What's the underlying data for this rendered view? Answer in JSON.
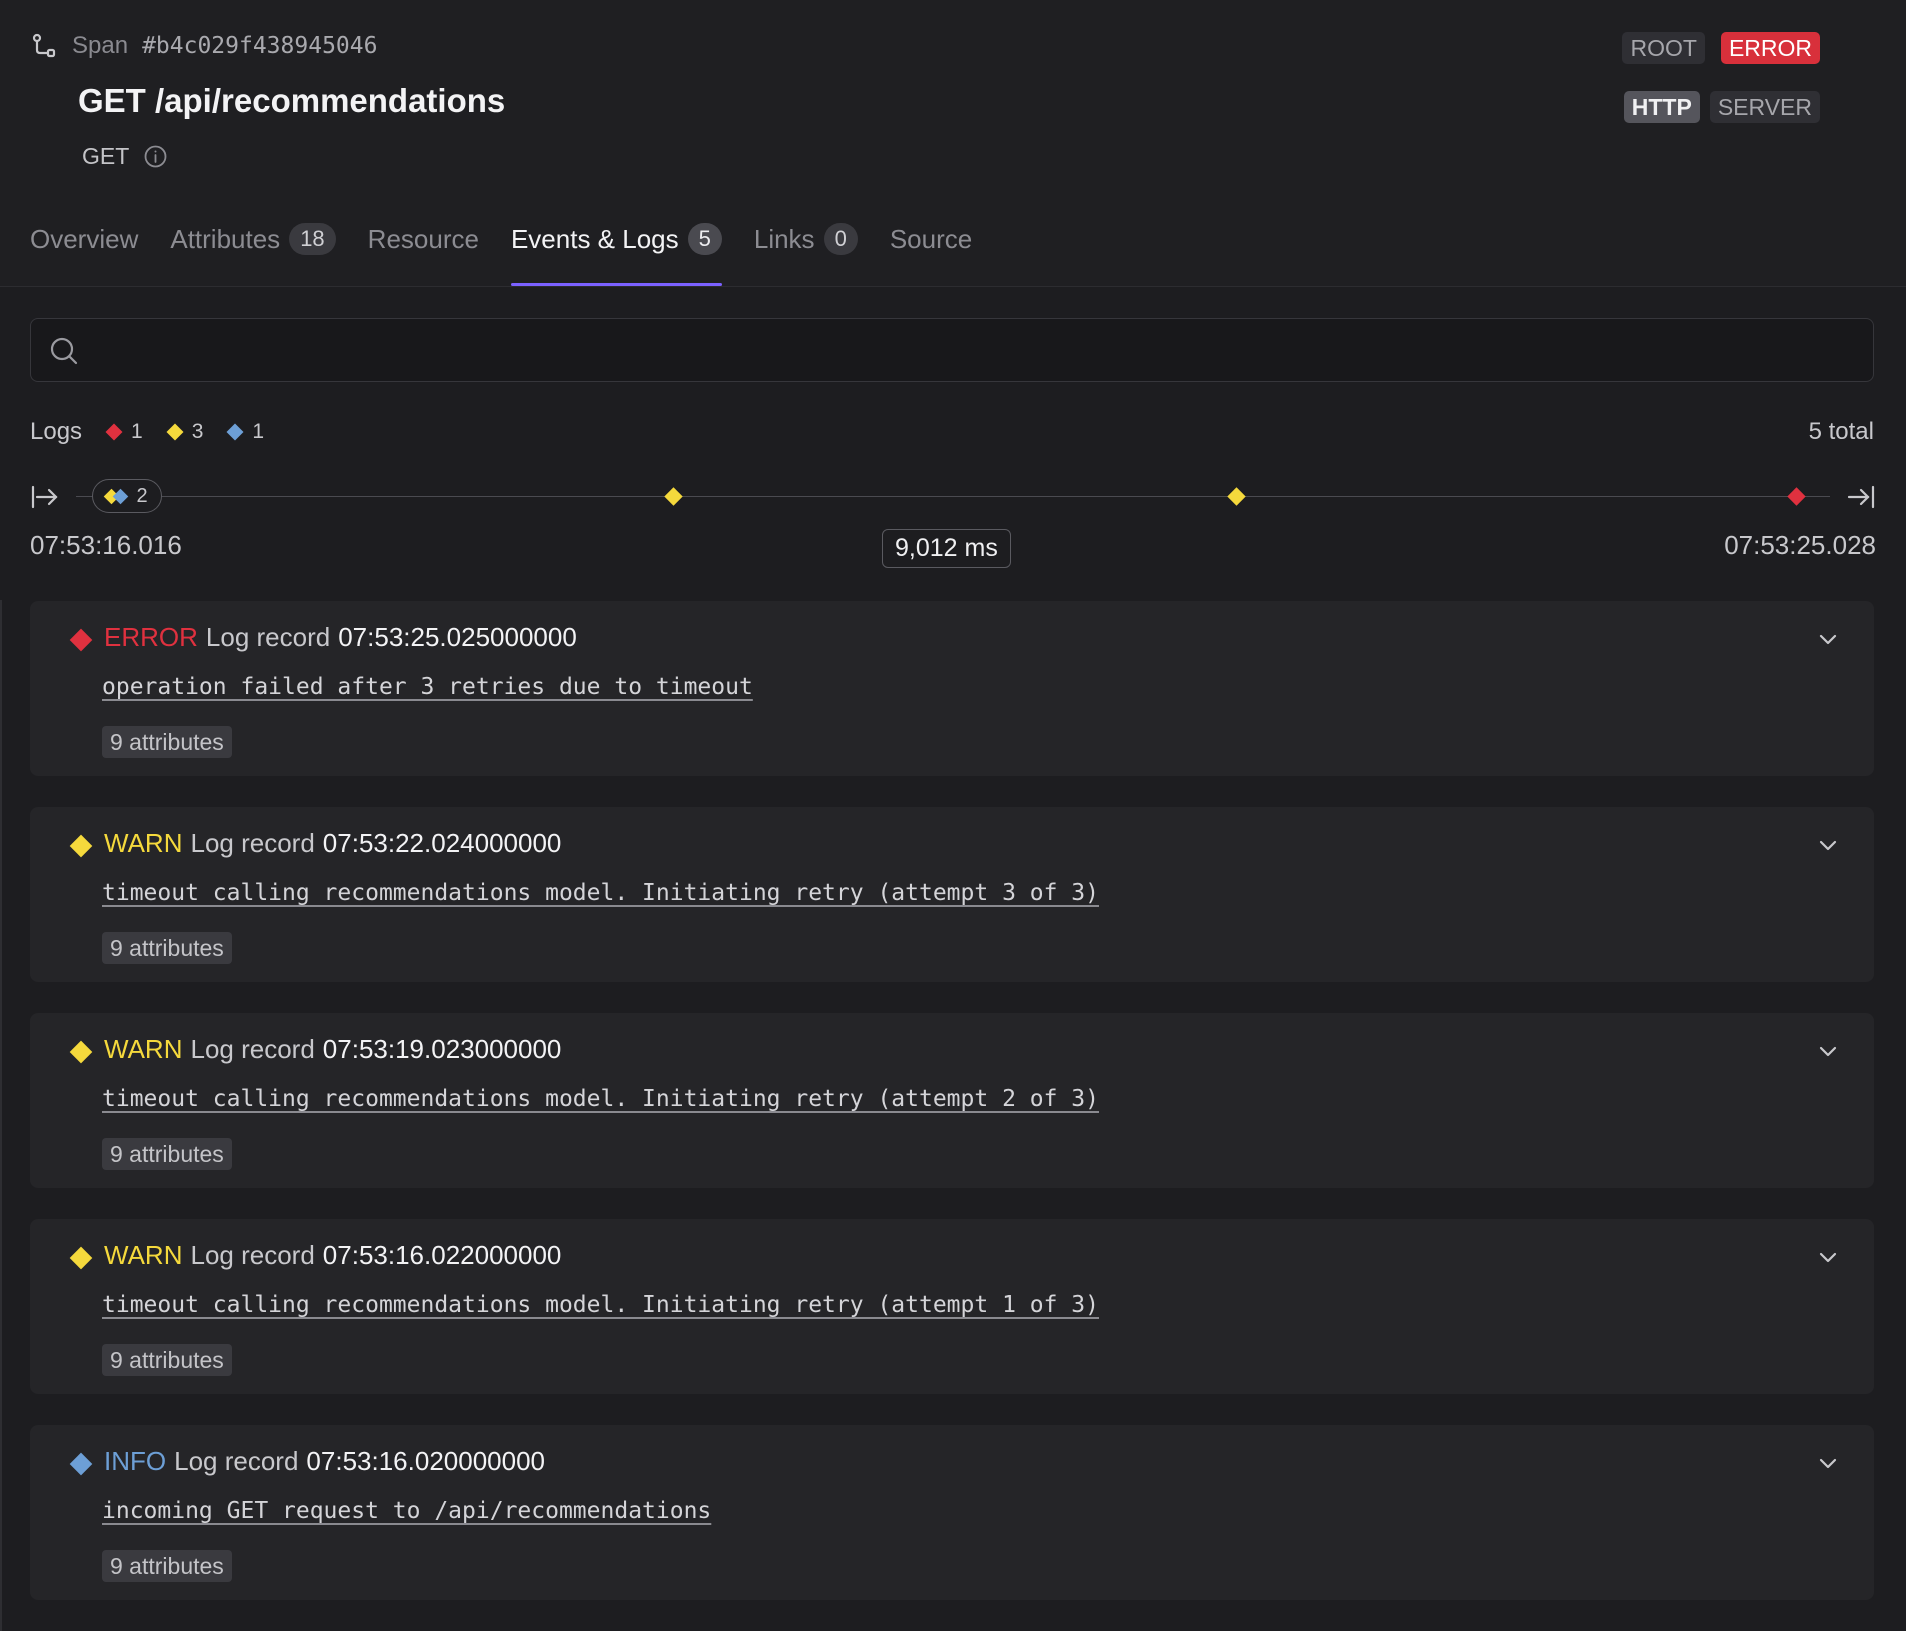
{
  "header": {
    "span_label": "Span",
    "span_id": "#b4c029f438945046",
    "title": "GET /api/recommendations",
    "method": "GET",
    "badges_top": [
      "ROOT",
      "ERROR"
    ],
    "badges_bottom": [
      "HTTP",
      "SERVER"
    ]
  },
  "tabs": [
    {
      "label": "Overview",
      "count": null,
      "active": false
    },
    {
      "label": "Attributes",
      "count": "18",
      "active": false
    },
    {
      "label": "Resource",
      "count": null,
      "active": false
    },
    {
      "label": "Events & Logs",
      "count": "5",
      "active": true
    },
    {
      "label": "Links",
      "count": "0",
      "active": false
    },
    {
      "label": "Source",
      "count": null,
      "active": false
    }
  ],
  "search": {
    "placeholder": "",
    "value": ""
  },
  "logs_summary": {
    "label": "Logs",
    "error_count": "1",
    "warn_count": "3",
    "info_count": "1",
    "total": "5 total"
  },
  "timeline": {
    "start": "07:53:16.016",
    "end": "07:53:25.028",
    "duration": "9,012 ms",
    "cluster_count": "2"
  },
  "colors": {
    "error": "#e0313f",
    "warn": "#f5d93c",
    "info": "#6d9fd6",
    "accent": "#7b61ff"
  },
  "logs": [
    {
      "level": "ERROR",
      "label": "Log record",
      "timestamp": "07:53:25.025000000",
      "message": "operation failed after 3 retries due to timeout",
      "attributes": "9 attributes"
    },
    {
      "level": "WARN",
      "label": "Log record",
      "timestamp": "07:53:22.024000000",
      "message": "timeout calling recommendations model. Initiating retry (attempt 3 of 3)",
      "attributes": "9 attributes"
    },
    {
      "level": "WARN",
      "label": "Log record",
      "timestamp": "07:53:19.023000000",
      "message": "timeout calling recommendations model. Initiating retry (attempt 2 of 3)",
      "attributes": "9 attributes"
    },
    {
      "level": "WARN",
      "label": "Log record",
      "timestamp": "07:53:16.022000000",
      "message": "timeout calling recommendations model. Initiating retry (attempt 1 of 3)",
      "attributes": "9 attributes"
    },
    {
      "level": "INFO",
      "label": "Log record",
      "timestamp": "07:53:16.020000000",
      "message": "incoming GET request to /api/recommendations",
      "attributes": "9 attributes"
    }
  ]
}
